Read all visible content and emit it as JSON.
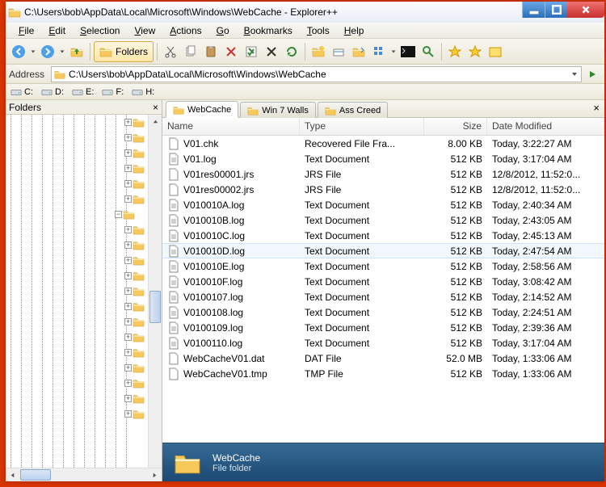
{
  "titlebar": {
    "title": "C:\\Users\\bob\\AppData\\Local\\Microsoft\\Windows\\WebCache - Explorer++"
  },
  "menu": {
    "file": "File",
    "edit": "Edit",
    "selection": "Selection",
    "view": "View",
    "actions": "Actions",
    "go": "Go",
    "bookmarks": "Bookmarks",
    "tools": "Tools",
    "help": "Help"
  },
  "toolbar": {
    "folders_label": "Folders"
  },
  "address": {
    "label": "Address",
    "value": "C:\\Users\\bob\\AppData\\Local\\Microsoft\\Windows\\WebCache"
  },
  "drives": [
    "C:",
    "D:",
    "E:",
    "F:",
    "H:"
  ],
  "folders_pane": {
    "title": "Folders"
  },
  "tabs": [
    {
      "label": "WebCache",
      "active": true
    },
    {
      "label": "Win 7 Walls",
      "active": false
    },
    {
      "label": "Ass Creed",
      "active": false
    }
  ],
  "columns": {
    "name": "Name",
    "type": "Type",
    "size": "Size",
    "date": "Date Modified"
  },
  "files": [
    {
      "name": "V01.chk",
      "type": "Recovered File Fra...",
      "size": "8.00 KB",
      "date": "Today, 3:22:27 AM",
      "icon": "page"
    },
    {
      "name": "V01.log",
      "type": "Text Document",
      "size": "512 KB",
      "date": "Today, 3:17:04 AM",
      "icon": "txt"
    },
    {
      "name": "V01res00001.jrs",
      "type": "JRS File",
      "size": "512 KB",
      "date": "12/8/2012, 11:52:0...",
      "icon": "page"
    },
    {
      "name": "V01res00002.jrs",
      "type": "JRS File",
      "size": "512 KB",
      "date": "12/8/2012, 11:52:0...",
      "icon": "page"
    },
    {
      "name": "V010010A.log",
      "type": "Text Document",
      "size": "512 KB",
      "date": "Today, 2:40:34 AM",
      "icon": "txt"
    },
    {
      "name": "V010010B.log",
      "type": "Text Document",
      "size": "512 KB",
      "date": "Today, 2:43:05 AM",
      "icon": "txt"
    },
    {
      "name": "V010010C.log",
      "type": "Text Document",
      "size": "512 KB",
      "date": "Today, 2:45:13 AM",
      "icon": "txt"
    },
    {
      "name": "V010010D.log",
      "type": "Text Document",
      "size": "512 KB",
      "date": "Today, 2:47:54 AM",
      "icon": "txt",
      "selected": true
    },
    {
      "name": "V010010E.log",
      "type": "Text Document",
      "size": "512 KB",
      "date": "Today, 2:58:56 AM",
      "icon": "txt"
    },
    {
      "name": "V010010F.log",
      "type": "Text Document",
      "size": "512 KB",
      "date": "Today, 3:08:42 AM",
      "icon": "txt"
    },
    {
      "name": "V0100107.log",
      "type": "Text Document",
      "size": "512 KB",
      "date": "Today, 2:14:52 AM",
      "icon": "txt"
    },
    {
      "name": "V0100108.log",
      "type": "Text Document",
      "size": "512 KB",
      "date": "Today, 2:24:51 AM",
      "icon": "txt"
    },
    {
      "name": "V0100109.log",
      "type": "Text Document",
      "size": "512 KB",
      "date": "Today, 2:39:36 AM",
      "icon": "txt"
    },
    {
      "name": "V0100110.log",
      "type": "Text Document",
      "size": "512 KB",
      "date": "Today, 3:17:04 AM",
      "icon": "txt"
    },
    {
      "name": "WebCacheV01.dat",
      "type": "DAT File",
      "size": "52.0 MB",
      "date": "Today, 1:33:06 AM",
      "icon": "page"
    },
    {
      "name": "WebCacheV01.tmp",
      "type": "TMP File",
      "size": "512 KB",
      "date": "Today, 1:33:06 AM",
      "icon": "page"
    }
  ],
  "detail": {
    "name": "WebCache",
    "type": "File folder"
  }
}
